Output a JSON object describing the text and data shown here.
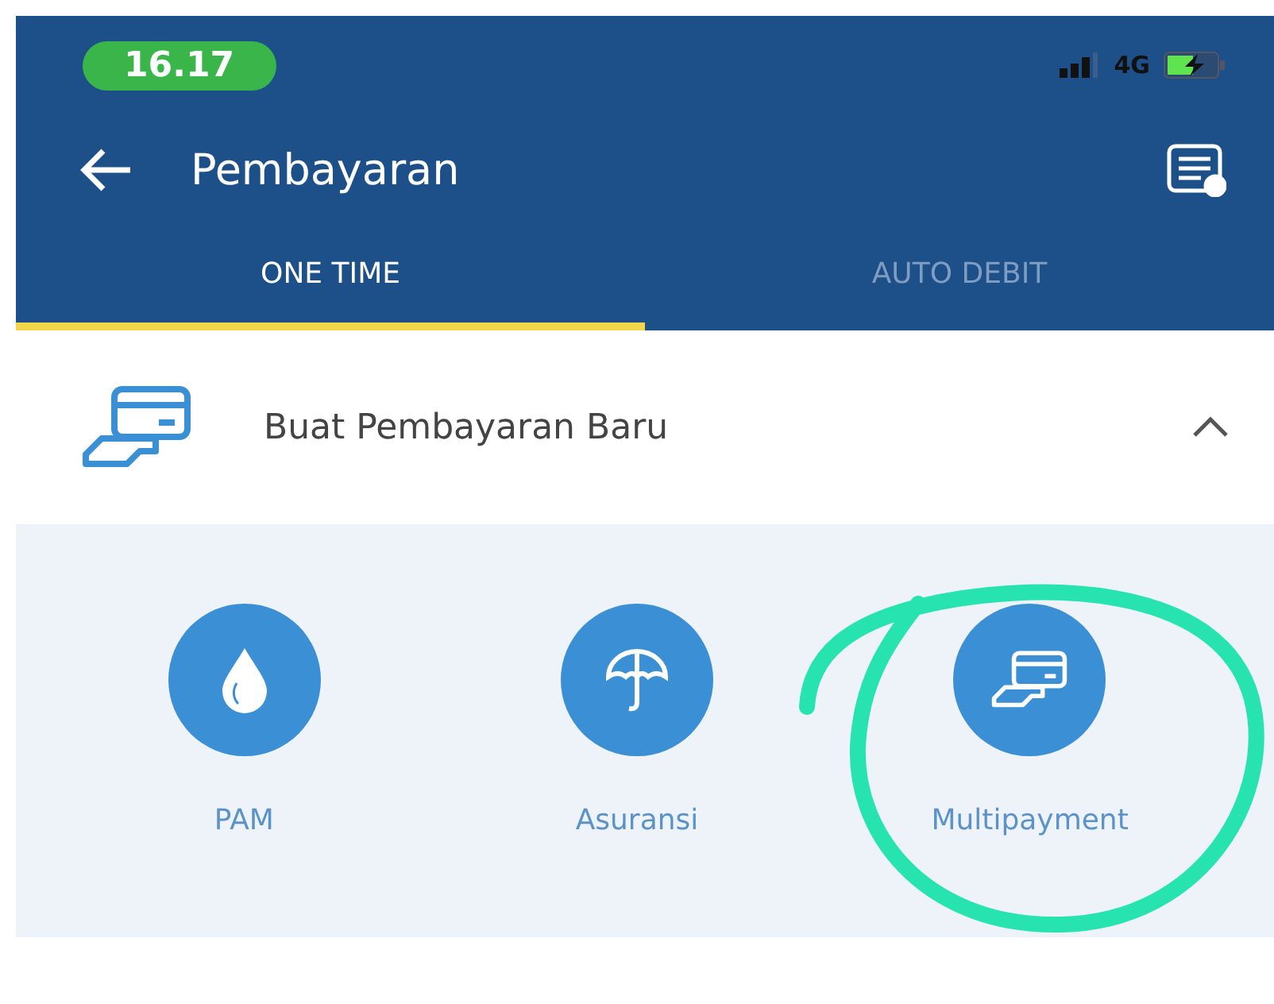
{
  "status_bar": {
    "time": "16.17",
    "network": "4G"
  },
  "app_bar": {
    "title": "Pembayaran"
  },
  "tabs": [
    {
      "label": "ONE TIME",
      "selected": true
    },
    {
      "label": "AUTO DEBIT",
      "selected": false
    }
  ],
  "section": {
    "title": "Buat Pembayaran Baru",
    "expanded": true
  },
  "items": [
    {
      "label": "PAM",
      "kind": "water",
      "highlighted": false
    },
    {
      "label": "Asuransi",
      "kind": "umbrella",
      "highlighted": false
    },
    {
      "label": "Multipayment",
      "kind": "card",
      "highlighted": true
    }
  ]
}
